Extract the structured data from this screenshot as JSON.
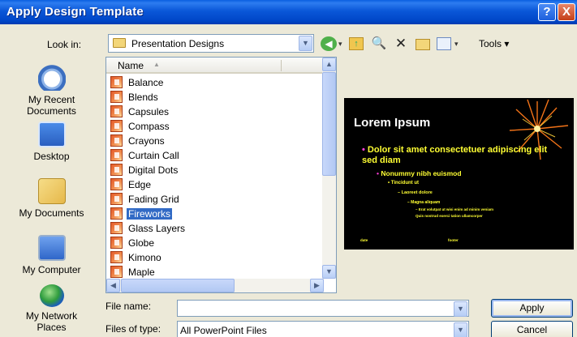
{
  "window": {
    "title": "Apply Design Template",
    "help_glyph": "?",
    "close_glyph": "X"
  },
  "lookin": {
    "label": "Look in:",
    "value": "Presentation Designs",
    "folder_icon": "folder-icon"
  },
  "toolbar": {
    "back_icon": "back-icon",
    "up_icon": "up-folder-icon",
    "search_icon": "search-web-icon",
    "delete_icon": "delete-icon",
    "new_folder_icon": "new-folder-icon",
    "views_icon": "views-icon",
    "tools_label": "Tools"
  },
  "places": [
    {
      "label_1": "My Recent",
      "label_2": "Documents",
      "icon": "recent-documents-icon"
    },
    {
      "label_1": "Desktop",
      "label_2": "",
      "icon": "desktop-icon"
    },
    {
      "label_1": "My Documents",
      "label_2": "",
      "icon": "my-documents-icon"
    },
    {
      "label_1": "My Computer",
      "label_2": "",
      "icon": "my-computer-icon"
    },
    {
      "label_1": "My Network",
      "label_2": "Places",
      "icon": "my-network-icon"
    }
  ],
  "list": {
    "column_name": "Name",
    "files": [
      "Balance",
      "Blends",
      "Capsules",
      "Compass",
      "Crayons",
      "Curtain Call",
      "Digital Dots",
      "Edge",
      "Fading Grid",
      "Fireworks",
      "Glass Layers",
      "Globe",
      "Kimono",
      "Maple"
    ],
    "selected": "Fireworks"
  },
  "preview": {
    "title": "Lorem Ipsum",
    "line1": "Dolor sit amet consectetuer adipiscing elit sed diam",
    "line2": "Nonummy nibh euismod",
    "line3": "Tincidunt ut",
    "line4": "Laoreet dolore",
    "line5": "Magna aliquam",
    "line6": "Erat volutpat ut wisi enim ad minim veniam",
    "line7": "Quis nostrud exerci tation ullamcorper",
    "footer_left": "date",
    "footer_mid": "footer"
  },
  "form": {
    "filename_label": "File name:",
    "filename_value": "",
    "filetype_label": "Files of type:",
    "filetype_value": "All PowerPoint Files",
    "apply_label": "Apply",
    "cancel_label": "Cancel"
  }
}
